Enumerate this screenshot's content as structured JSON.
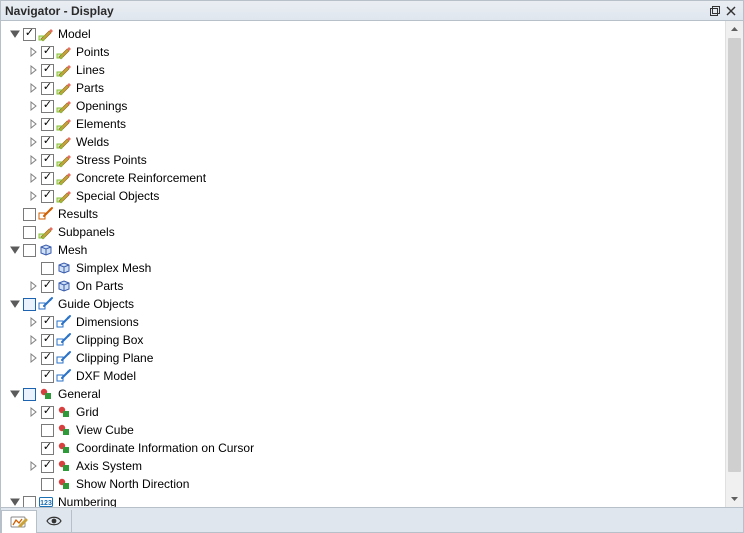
{
  "title": "Navigator - Display",
  "icons": {
    "pencil-green": {
      "type": "pencil",
      "accent": "#86c232"
    },
    "results-pointer": {
      "type": "pointer",
      "accent": "#d06000"
    },
    "subpanels": {
      "type": "pencil",
      "accent": "#86c232"
    },
    "mesh-cube": {
      "type": "cube",
      "accent": "#3a5cae"
    },
    "guide-pointer": {
      "type": "pointer",
      "accent": "#2a72c8"
    },
    "shapes": {
      "type": "shapes",
      "accent": "#d84040"
    },
    "numbering": {
      "type": "numbox",
      "accent": "#1b6fb3"
    }
  },
  "tree": [
    {
      "depth": 0,
      "expand": "open",
      "checked": "checked",
      "icon": "pencil-green",
      "label": "Model"
    },
    {
      "depth": 1,
      "expand": "closed",
      "checked": "checked",
      "icon": "pencil-green",
      "label": "Points"
    },
    {
      "depth": 1,
      "expand": "closed",
      "checked": "checked",
      "icon": "pencil-green",
      "label": "Lines"
    },
    {
      "depth": 1,
      "expand": "closed",
      "checked": "checked",
      "icon": "pencil-green",
      "label": "Parts"
    },
    {
      "depth": 1,
      "expand": "closed",
      "checked": "checked",
      "icon": "pencil-green",
      "label": "Openings"
    },
    {
      "depth": 1,
      "expand": "closed",
      "checked": "checked",
      "icon": "pencil-green",
      "label": "Elements"
    },
    {
      "depth": 1,
      "expand": "closed",
      "checked": "checked",
      "icon": "pencil-green",
      "label": "Welds"
    },
    {
      "depth": 1,
      "expand": "closed",
      "checked": "checked",
      "icon": "pencil-green",
      "label": "Stress Points"
    },
    {
      "depth": 1,
      "expand": "closed",
      "checked": "checked",
      "icon": "pencil-green",
      "label": "Concrete Reinforcement"
    },
    {
      "depth": 1,
      "expand": "closed",
      "checked": "checked",
      "icon": "pencil-green",
      "label": "Special Objects"
    },
    {
      "depth": 1,
      "expand": "none",
      "checked": "unchecked",
      "icon": "results-pointer",
      "label": "Results",
      "extraIndent": -18
    },
    {
      "depth": 1,
      "expand": "none",
      "checked": "unchecked",
      "icon": "subpanels",
      "label": "Subpanels",
      "extraIndent": -18
    },
    {
      "depth": 0,
      "expand": "open",
      "checked": "unchecked",
      "icon": "mesh-cube",
      "label": "Mesh"
    },
    {
      "depth": 1,
      "expand": "none",
      "checked": "unchecked",
      "icon": "mesh-cube",
      "label": "Simplex Mesh"
    },
    {
      "depth": 1,
      "expand": "closed",
      "checked": "checked",
      "icon": "mesh-cube",
      "label": "On Parts"
    },
    {
      "depth": 0,
      "expand": "open",
      "checked": "partial",
      "icon": "guide-pointer",
      "label": "Guide Objects"
    },
    {
      "depth": 1,
      "expand": "closed",
      "checked": "checked",
      "icon": "guide-pointer",
      "label": "Dimensions"
    },
    {
      "depth": 1,
      "expand": "closed",
      "checked": "checked",
      "icon": "guide-pointer",
      "label": "Clipping Box"
    },
    {
      "depth": 1,
      "expand": "closed",
      "checked": "checked",
      "icon": "guide-pointer",
      "label": "Clipping Plane"
    },
    {
      "depth": 1,
      "expand": "none",
      "checked": "checked",
      "icon": "guide-pointer",
      "label": "DXF Model"
    },
    {
      "depth": 0,
      "expand": "open",
      "checked": "partial",
      "icon": "shapes",
      "label": "General"
    },
    {
      "depth": 1,
      "expand": "closed",
      "checked": "checked",
      "icon": "shapes",
      "label": "Grid"
    },
    {
      "depth": 1,
      "expand": "none",
      "checked": "unchecked",
      "icon": "shapes",
      "label": "View Cube"
    },
    {
      "depth": 1,
      "expand": "none",
      "checked": "checked",
      "icon": "shapes",
      "label": "Coordinate Information on Cursor"
    },
    {
      "depth": 1,
      "expand": "closed",
      "checked": "checked",
      "icon": "shapes",
      "label": "Axis System"
    },
    {
      "depth": 1,
      "expand": "none",
      "checked": "unchecked",
      "icon": "shapes",
      "label": "Show North Direction"
    },
    {
      "depth": 0,
      "expand": "open",
      "checked": "unchecked",
      "icon": "numbering",
      "label": "Numbering"
    }
  ],
  "tabs": {
    "active": 0,
    "items": [
      "display-settings",
      "visibility"
    ]
  }
}
